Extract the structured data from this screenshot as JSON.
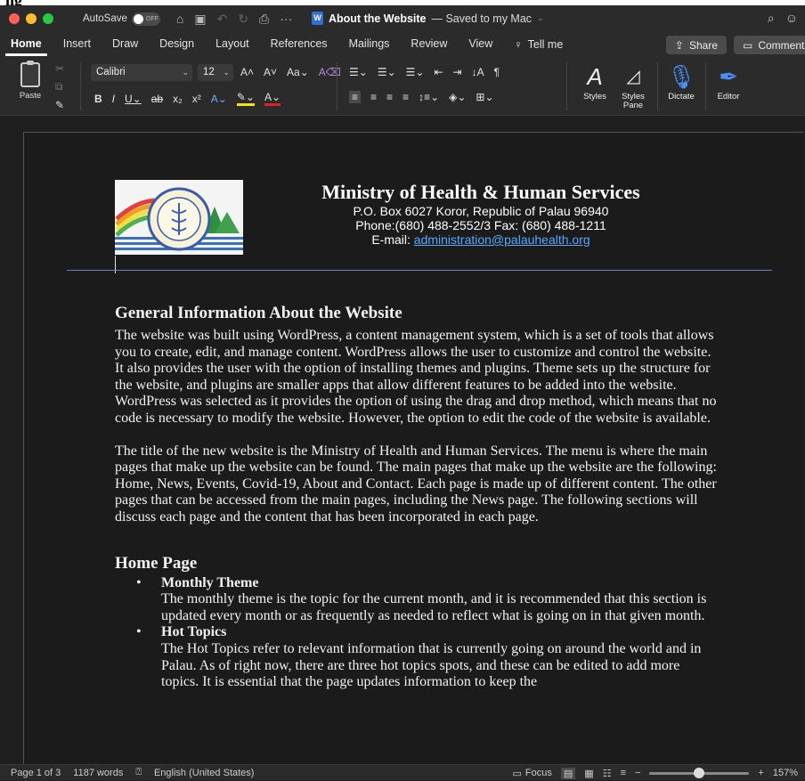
{
  "window": {
    "autosave_label": "AutoSave",
    "autosave_state": "OFF",
    "doc_name": "About the Website",
    "save_status": "— Saved to my Mac",
    "cropped_top_text": "ng"
  },
  "tabs": [
    "Home",
    "Insert",
    "Draw",
    "Design",
    "Layout",
    "References",
    "Mailings",
    "Review",
    "View"
  ],
  "tell_me": "Tell me",
  "share_label": "Share",
  "comments_label": "Comments",
  "ribbon": {
    "paste_label": "Paste",
    "font_name": "Calibri",
    "font_size": "12",
    "styles_label": "Styles",
    "styles_pane_label": "Styles Pane",
    "dictate_label": "Dictate",
    "editor_label": "Editor"
  },
  "letterhead": {
    "org": "Ministry of Health & Human Services",
    "address": "P.O. Box 6027 Koror, Republic of Palau 96940",
    "phone": "Phone:(680) 488-2552/3 Fax: (680) 488-1211",
    "email_prefix": "E-mail: ",
    "email": "administration@palauhealth.org"
  },
  "content": {
    "heading1": "General Information About the Website",
    "para1": "The website was built using WordPress, a content management system, which is a set of tools that allows you to create, edit, and manage content. WordPress allows the user to customize and control the website. It also provides the user with the option of installing themes and plugins. Theme sets up the structure for the website, and plugins are smaller apps that allow different features to be added into the website. WordPress was selected as it provides the option of using the drag and drop method, which means that no code is necessary to modify the website. However, the option to edit the code of the website is available.",
    "para2": "The title of the new website is the Ministry of Health and Human Services. The menu is where the main pages that make up the website can be found. The main pages that make up the website are the following: Home, News, Events, Covid-19, About and Contact. Each page is made up of different content. The other pages that can be accessed from the main pages, including the News page. The following sections will discuss each page and the content that has been incorporated in each page.",
    "heading2": "Home Page",
    "items": [
      {
        "title": "Monthly Theme",
        "text": "The monthly theme is the topic for the current month, and it is recommended that this section is updated every month or as frequently as needed to reflect what is going on in that given month."
      },
      {
        "title": "Hot Topics",
        "text": "The Hot Topics refer to relevant information that is currently going on around the world and in Palau. As of right now, there are three hot topics spots, and these can be edited to add more topics. It is essential that the page updates information to keep the"
      }
    ]
  },
  "status": {
    "page": "Page 1 of 3",
    "words": "1187 words",
    "language": "English (United States)",
    "focus": "Focus",
    "zoom": "157%",
    "zoom_level_fraction": 0.5
  }
}
